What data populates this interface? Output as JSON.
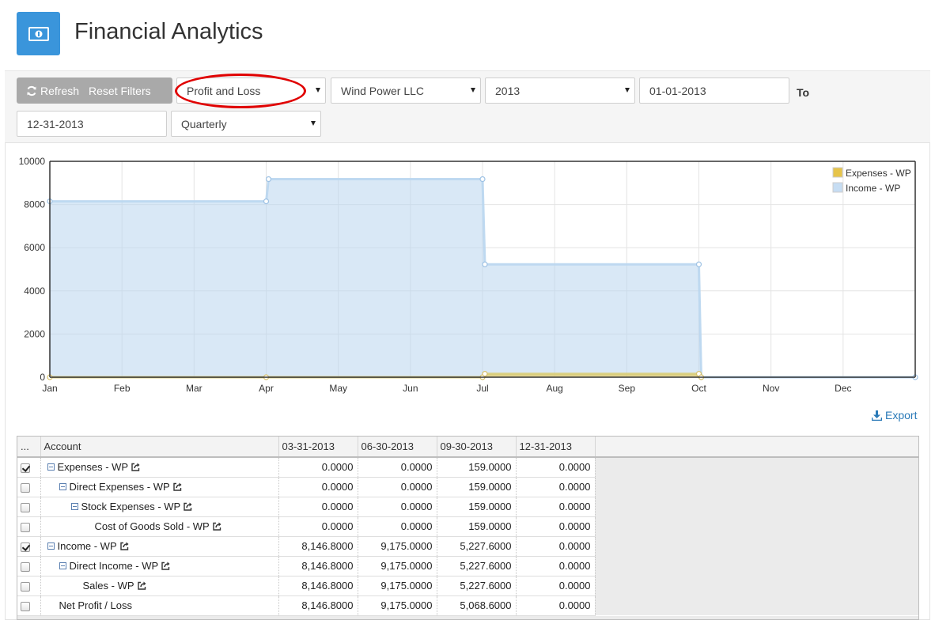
{
  "app": {
    "title": "Financial Analytics"
  },
  "toolbar": {
    "refresh_label": "Refresh",
    "reset_label": "Reset Filters",
    "report_type": "Profit and Loss",
    "company": "Wind Power LLC",
    "year": "2013",
    "from_date": "01-01-2013",
    "to_label": "To",
    "to_date": "12-31-2013",
    "periodicity": "Quarterly"
  },
  "chart_data": {
    "type": "area",
    "x": [
      "Jan",
      "Feb",
      "Mar",
      "Apr",
      "May",
      "Jun",
      "Jul",
      "Aug",
      "Sep",
      "Oct",
      "Nov",
      "Dec"
    ],
    "ylim": [
      0,
      10000
    ],
    "yticks": [
      "10000",
      "8000",
      "6000",
      "4000",
      "2000",
      "0"
    ],
    "grid": true,
    "legend_position": "top-right",
    "series": [
      {
        "name": "Expenses - WP",
        "color": "#e6c44a",
        "points": [
          [
            "Jan",
            0
          ],
          [
            "Apr",
            0
          ],
          [
            "Jul",
            0
          ],
          [
            "Jul",
            159
          ],
          [
            "Oct",
            159
          ],
          [
            "Oct",
            0
          ],
          [
            "Jan",
            0
          ]
        ]
      },
      {
        "name": "Income - WP",
        "color": "#b9d6ef",
        "points": [
          [
            "Jan",
            8146.8
          ],
          [
            "Apr",
            8146.8
          ],
          [
            "Apr",
            9175
          ],
          [
            "Jul",
            9175
          ],
          [
            "Jul",
            5227.6
          ],
          [
            "Oct",
            5227.6
          ],
          [
            "Oct",
            0
          ],
          [
            "Jan",
            0
          ]
        ]
      }
    ]
  },
  "export_label": "Export",
  "table": {
    "columns": [
      "...",
      "Account",
      "03-31-2013",
      "06-30-2013",
      "09-30-2013",
      "12-31-2013"
    ],
    "rows": [
      {
        "checked": true,
        "collapsible": true,
        "link": true,
        "account": "Expenses - WP",
        "values": [
          "0.0000",
          "0.0000",
          "159.0000",
          "0.0000"
        ]
      },
      {
        "checked": false,
        "collapsible": true,
        "link": true,
        "account": "Direct Expenses - WP",
        "values": [
          "0.0000",
          "0.0000",
          "159.0000",
          "0.0000"
        ]
      },
      {
        "checked": false,
        "collapsible": true,
        "link": true,
        "account": "Stock Expenses - WP",
        "values": [
          "0.0000",
          "0.0000",
          "159.0000",
          "0.0000"
        ]
      },
      {
        "checked": false,
        "collapsible": false,
        "link": true,
        "account": "Cost of Goods Sold - WP",
        "values": [
          "0.0000",
          "0.0000",
          "159.0000",
          "0.0000"
        ]
      },
      {
        "checked": true,
        "collapsible": true,
        "link": true,
        "account": "Income - WP",
        "values": [
          "8,146.8000",
          "9,175.0000",
          "5,227.6000",
          "0.0000"
        ]
      },
      {
        "checked": false,
        "collapsible": true,
        "link": true,
        "account": "Direct Income - WP",
        "values": [
          "8,146.8000",
          "9,175.0000",
          "5,227.6000",
          "0.0000"
        ]
      },
      {
        "checked": false,
        "collapsible": false,
        "link": true,
        "account": "Sales - WP",
        "values": [
          "8,146.8000",
          "9,175.0000",
          "5,227.6000",
          "0.0000"
        ]
      },
      {
        "checked": false,
        "collapsible": false,
        "link": false,
        "account": "Net Profit / Loss",
        "values": [
          "8,146.8000",
          "9,175.0000",
          "5,068.6000",
          "0.0000"
        ]
      }
    ]
  }
}
